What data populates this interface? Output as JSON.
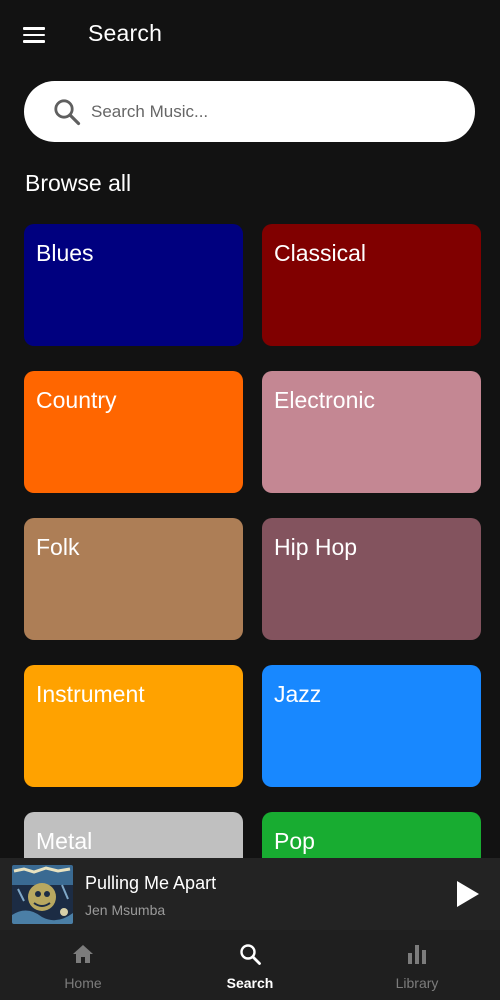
{
  "header": {
    "title": "Search"
  },
  "search": {
    "placeholder": "Search Music..."
  },
  "browse": {
    "title": "Browse all",
    "genres": [
      {
        "label": "Blues",
        "color": "#00007f"
      },
      {
        "label": "Classical",
        "color": "#800000"
      },
      {
        "label": "Country",
        "color": "#ff6600"
      },
      {
        "label": "Electronic",
        "color": "#c48793"
      },
      {
        "label": "Folk",
        "color": "#ad7e56"
      },
      {
        "label": "Hip Hop",
        "color": "#83535e"
      },
      {
        "label": "Instrument",
        "color": "#ffa200"
      },
      {
        "label": "Jazz",
        "color": "#1888ff"
      },
      {
        "label": "Metal",
        "color": "#c0c0c0"
      },
      {
        "label": "Pop",
        "color": "#18ac31"
      }
    ]
  },
  "player": {
    "title": "Pulling Me Apart",
    "artist": "Jen Msumba",
    "icon": "play-icon"
  },
  "nav": {
    "items": [
      {
        "label": "Home",
        "icon": "home-icon",
        "active": false
      },
      {
        "label": "Search",
        "icon": "search-icon",
        "active": true
      },
      {
        "label": "Library",
        "icon": "library-icon",
        "active": false
      }
    ]
  },
  "colors": {
    "background": "#121212",
    "player_bg": "#232323",
    "nav_bg": "#1f1f1f",
    "inactive_nav": "#7c7c7c"
  }
}
